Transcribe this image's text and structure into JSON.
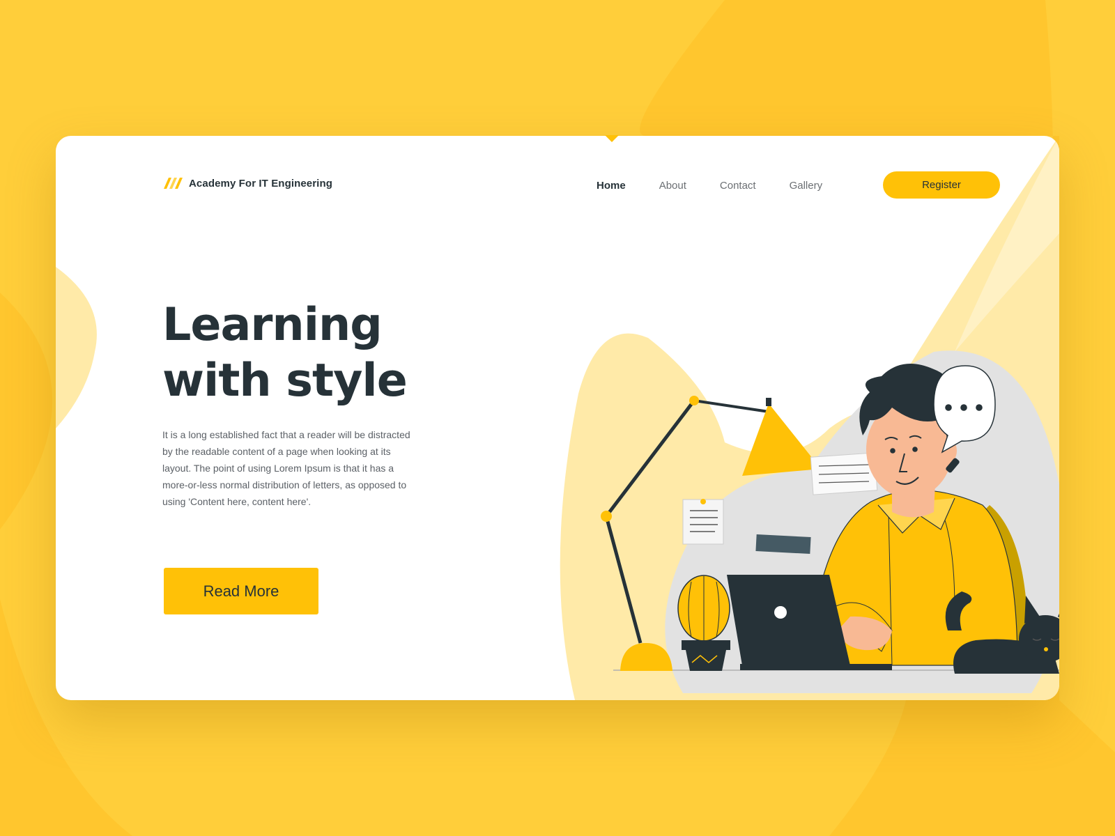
{
  "header": {
    "brand": "Academy For IT Engineering",
    "nav": [
      {
        "label": "Home",
        "active": true
      },
      {
        "label": "About",
        "active": false
      },
      {
        "label": "Contact",
        "active": false
      },
      {
        "label": "Gallery",
        "active": false
      }
    ],
    "register_label": "Register"
  },
  "hero": {
    "title_line1": "Learning",
    "title_line2": "with style",
    "description": "It is a long established fact that a reader will be distracted by the readable content of a page when looking at its layout. The point of using Lorem Ipsum is that it has a more-or-less normal distribution of letters, as opposed to using 'Content here, content here'.",
    "cta_label": "Read More"
  },
  "illustration": {
    "icons": [
      "desk-lamp-icon",
      "cactus-icon",
      "laptop-icon",
      "speech-bubble-icon",
      "cat-icon",
      "person-icon"
    ]
  },
  "colors": {
    "accent": "#FFC107",
    "background": "#FFCE3A",
    "light_accent": "#FFEAA8",
    "text_dark": "#263238",
    "text_muted": "#6b6f73"
  }
}
